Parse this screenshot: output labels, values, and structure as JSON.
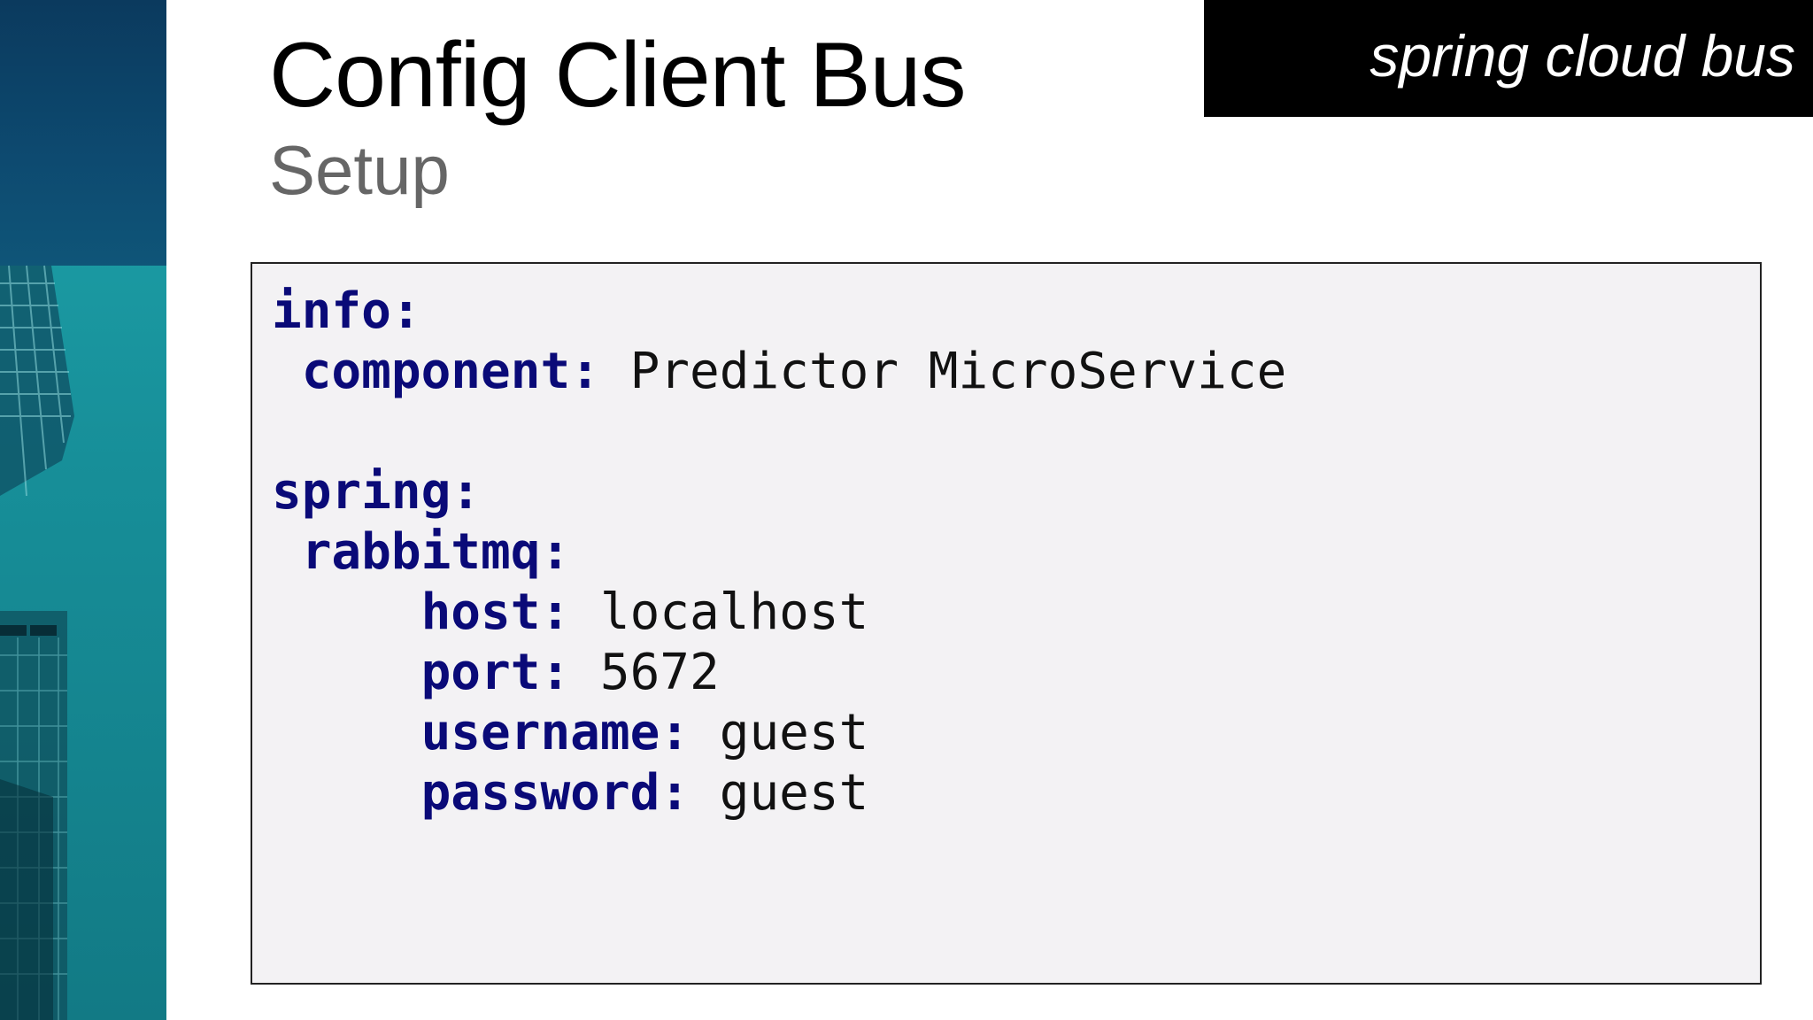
{
  "slide": {
    "title": "Config Client Bus",
    "subtitle": "Setup",
    "banner": "spring cloud bus"
  },
  "code": {
    "info_key": "info:",
    "component_key": "component:",
    "component_value": "Predictor MicroService",
    "spring_key": "spring:",
    "rabbitmq_key": "rabbitmq:",
    "host_key": "host:",
    "host_value": "localhost",
    "port_key": "port:",
    "port_value": "5672",
    "username_key": "username:",
    "username_value": "guest",
    "password_key": "password:",
    "password_value": "guest"
  },
  "colors": {
    "key": "#0a0a78",
    "value": "#111111",
    "code_background": "#f3f2f4",
    "banner_background": "#000000",
    "side_image_teal": "#1fa6ad",
    "side_image_navy": "#0b3a5e"
  }
}
